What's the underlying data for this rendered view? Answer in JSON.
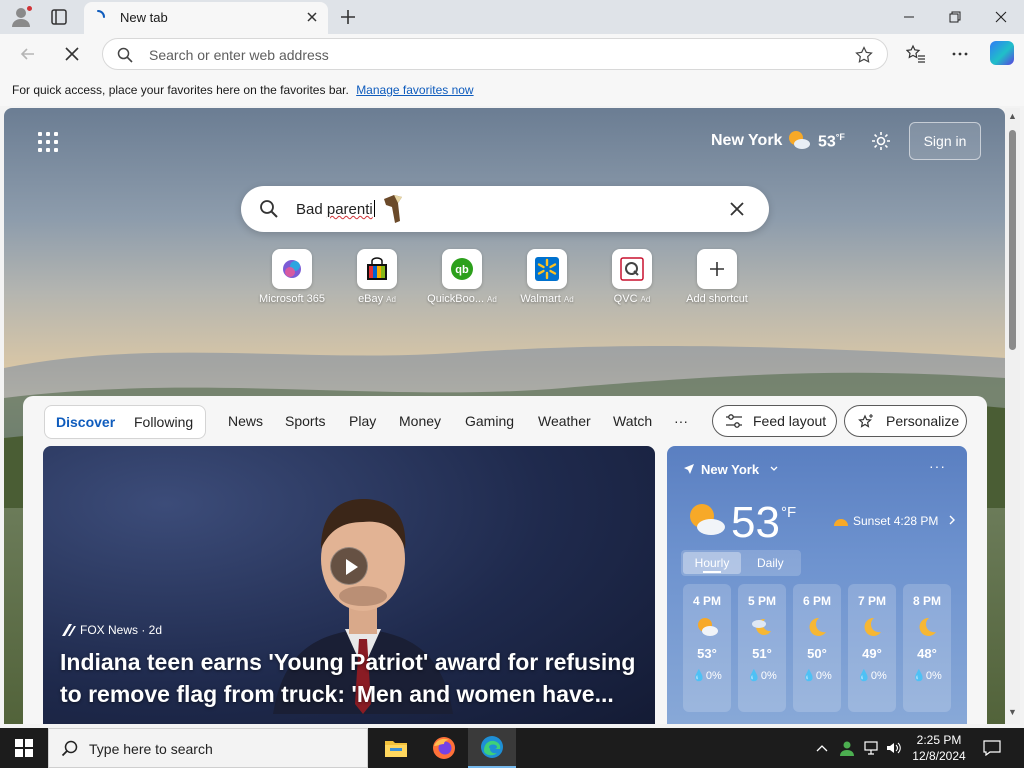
{
  "browser": {
    "tab_title": "New tab",
    "address_placeholder": "Search or enter web address",
    "favorites_hint": "For quick access, place your favorites here on the favorites bar.",
    "favorites_link": "Manage favorites now"
  },
  "newtab": {
    "header": {
      "city": "New York",
      "temp": "53",
      "unit": "°F",
      "signin_label": "Sign in"
    },
    "search": {
      "typed_text_plain": "Bad ",
      "typed_text_flagged": "parenti"
    },
    "shortcuts": [
      {
        "label": "Microsoft 365",
        "ad": ""
      },
      {
        "label": "eBay",
        "ad": "Ad"
      },
      {
        "label": "QuickBoo...",
        "ad": "Ad"
      },
      {
        "label": "Walmart",
        "ad": "Ad"
      },
      {
        "label": "QVC",
        "ad": "Ad"
      },
      {
        "label": "Add shortcut",
        "ad": ""
      }
    ]
  },
  "feed": {
    "pills": [
      "Discover",
      "Following"
    ],
    "tabs": [
      "News",
      "Sports",
      "Play",
      "Money",
      "Gaming",
      "Weather",
      "Watch",
      "···"
    ],
    "buttons": {
      "feed_layout": "Feed layout",
      "personalize": "Personalize"
    },
    "hero": {
      "source": "FOX News · 2d",
      "headline": "Indiana teen earns 'Young Patriot' award for refusing to remove flag from truck: 'Men and women have..."
    },
    "weather": {
      "location": "New York",
      "temp": "53",
      "unit": "°F",
      "sunset": "Sunset 4:28 PM",
      "toggle": [
        "Hourly",
        "Daily"
      ],
      "hourly": [
        {
          "hour": "4 PM",
          "temp": "53°",
          "precip": "0%",
          "icon": "sun-cloud-icon"
        },
        {
          "hour": "5 PM",
          "temp": "51°",
          "precip": "0%",
          "icon": "cloud-moon-icon"
        },
        {
          "hour": "6 PM",
          "temp": "50°",
          "precip": "0%",
          "icon": "moon-icon"
        },
        {
          "hour": "7 PM",
          "temp": "49°",
          "precip": "0%",
          "icon": "moon-icon"
        },
        {
          "hour": "8 PM",
          "temp": "48°",
          "precip": "0%",
          "icon": "moon-icon"
        }
      ]
    }
  },
  "taskbar": {
    "search_placeholder": "Type here to search",
    "time": "2:25 PM",
    "date": "12/8/2024"
  },
  "colors": {
    "accent": "#0f5cbd",
    "taskbar": "#1c1c1c"
  }
}
